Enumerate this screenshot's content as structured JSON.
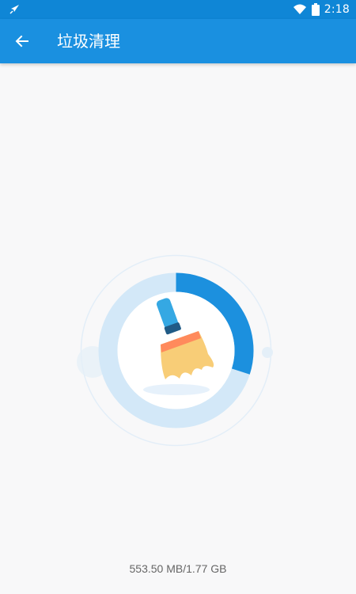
{
  "status_bar": {
    "time": "2:18",
    "left_icon": "rocket-icon",
    "wifi_icon": "wifi-icon",
    "battery_icon": "battery-icon"
  },
  "app_bar": {
    "title": "垃圾清理",
    "back_icon": "arrow-left-icon"
  },
  "cleaner": {
    "icon": "broom-icon",
    "used_fraction": 0.3
  },
  "storage": {
    "summary": "553.50 MB/1.77 GB"
  },
  "colors": {
    "status_bar": "#0f86d6",
    "app_bar": "#1a90e0",
    "ring_fill": "#1c90de",
    "ring_track": "#d3e8f8",
    "background": "#f8f8f9"
  }
}
